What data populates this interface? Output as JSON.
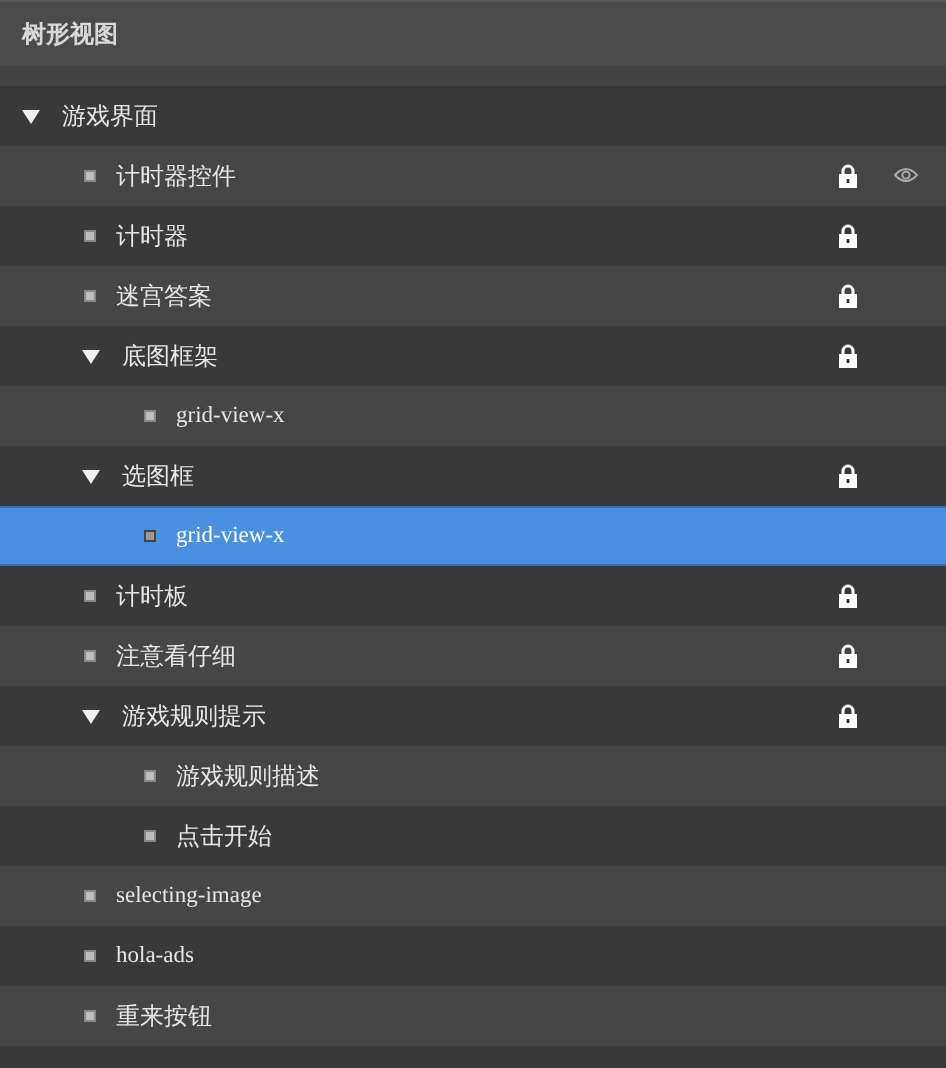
{
  "panel": {
    "title": "树形视图"
  },
  "tree": [
    {
      "label": "游戏界面",
      "expanded": true,
      "selected": false,
      "locked": false,
      "eye": false,
      "children": [
        {
          "label": "计时器控件",
          "selected": false,
          "locked": true,
          "eye": true
        },
        {
          "label": "计时器",
          "selected": false,
          "locked": true,
          "eye": false
        },
        {
          "label": "迷宫答案",
          "selected": false,
          "locked": true,
          "eye": false
        },
        {
          "label": "底图框架",
          "expanded": true,
          "selected": false,
          "locked": true,
          "eye": false,
          "children": [
            {
              "label": "grid-view-x",
              "selected": false,
              "locked": false,
              "eye": false
            }
          ]
        },
        {
          "label": "选图框",
          "expanded": true,
          "selected": false,
          "locked": true,
          "eye": false,
          "children": [
            {
              "label": "grid-view-x",
              "selected": true,
              "locked": false,
              "eye": false
            }
          ]
        },
        {
          "label": "计时板",
          "selected": false,
          "locked": true,
          "eye": false
        },
        {
          "label": "注意看仔细",
          "selected": false,
          "locked": true,
          "eye": false
        },
        {
          "label": "游戏规则提示",
          "expanded": true,
          "selected": false,
          "locked": true,
          "eye": false,
          "children": [
            {
              "label": "游戏规则描述",
              "selected": false,
              "locked": false,
              "eye": false
            },
            {
              "label": "点击开始",
              "selected": false,
              "locked": false,
              "eye": false
            }
          ]
        },
        {
          "label": "selecting-image",
          "selected": false,
          "locked": false,
          "eye": false
        },
        {
          "label": "hola-ads",
          "selected": false,
          "locked": false,
          "eye": false
        },
        {
          "label": "重来按钮",
          "selected": false,
          "locked": false,
          "eye": false
        }
      ]
    }
  ]
}
